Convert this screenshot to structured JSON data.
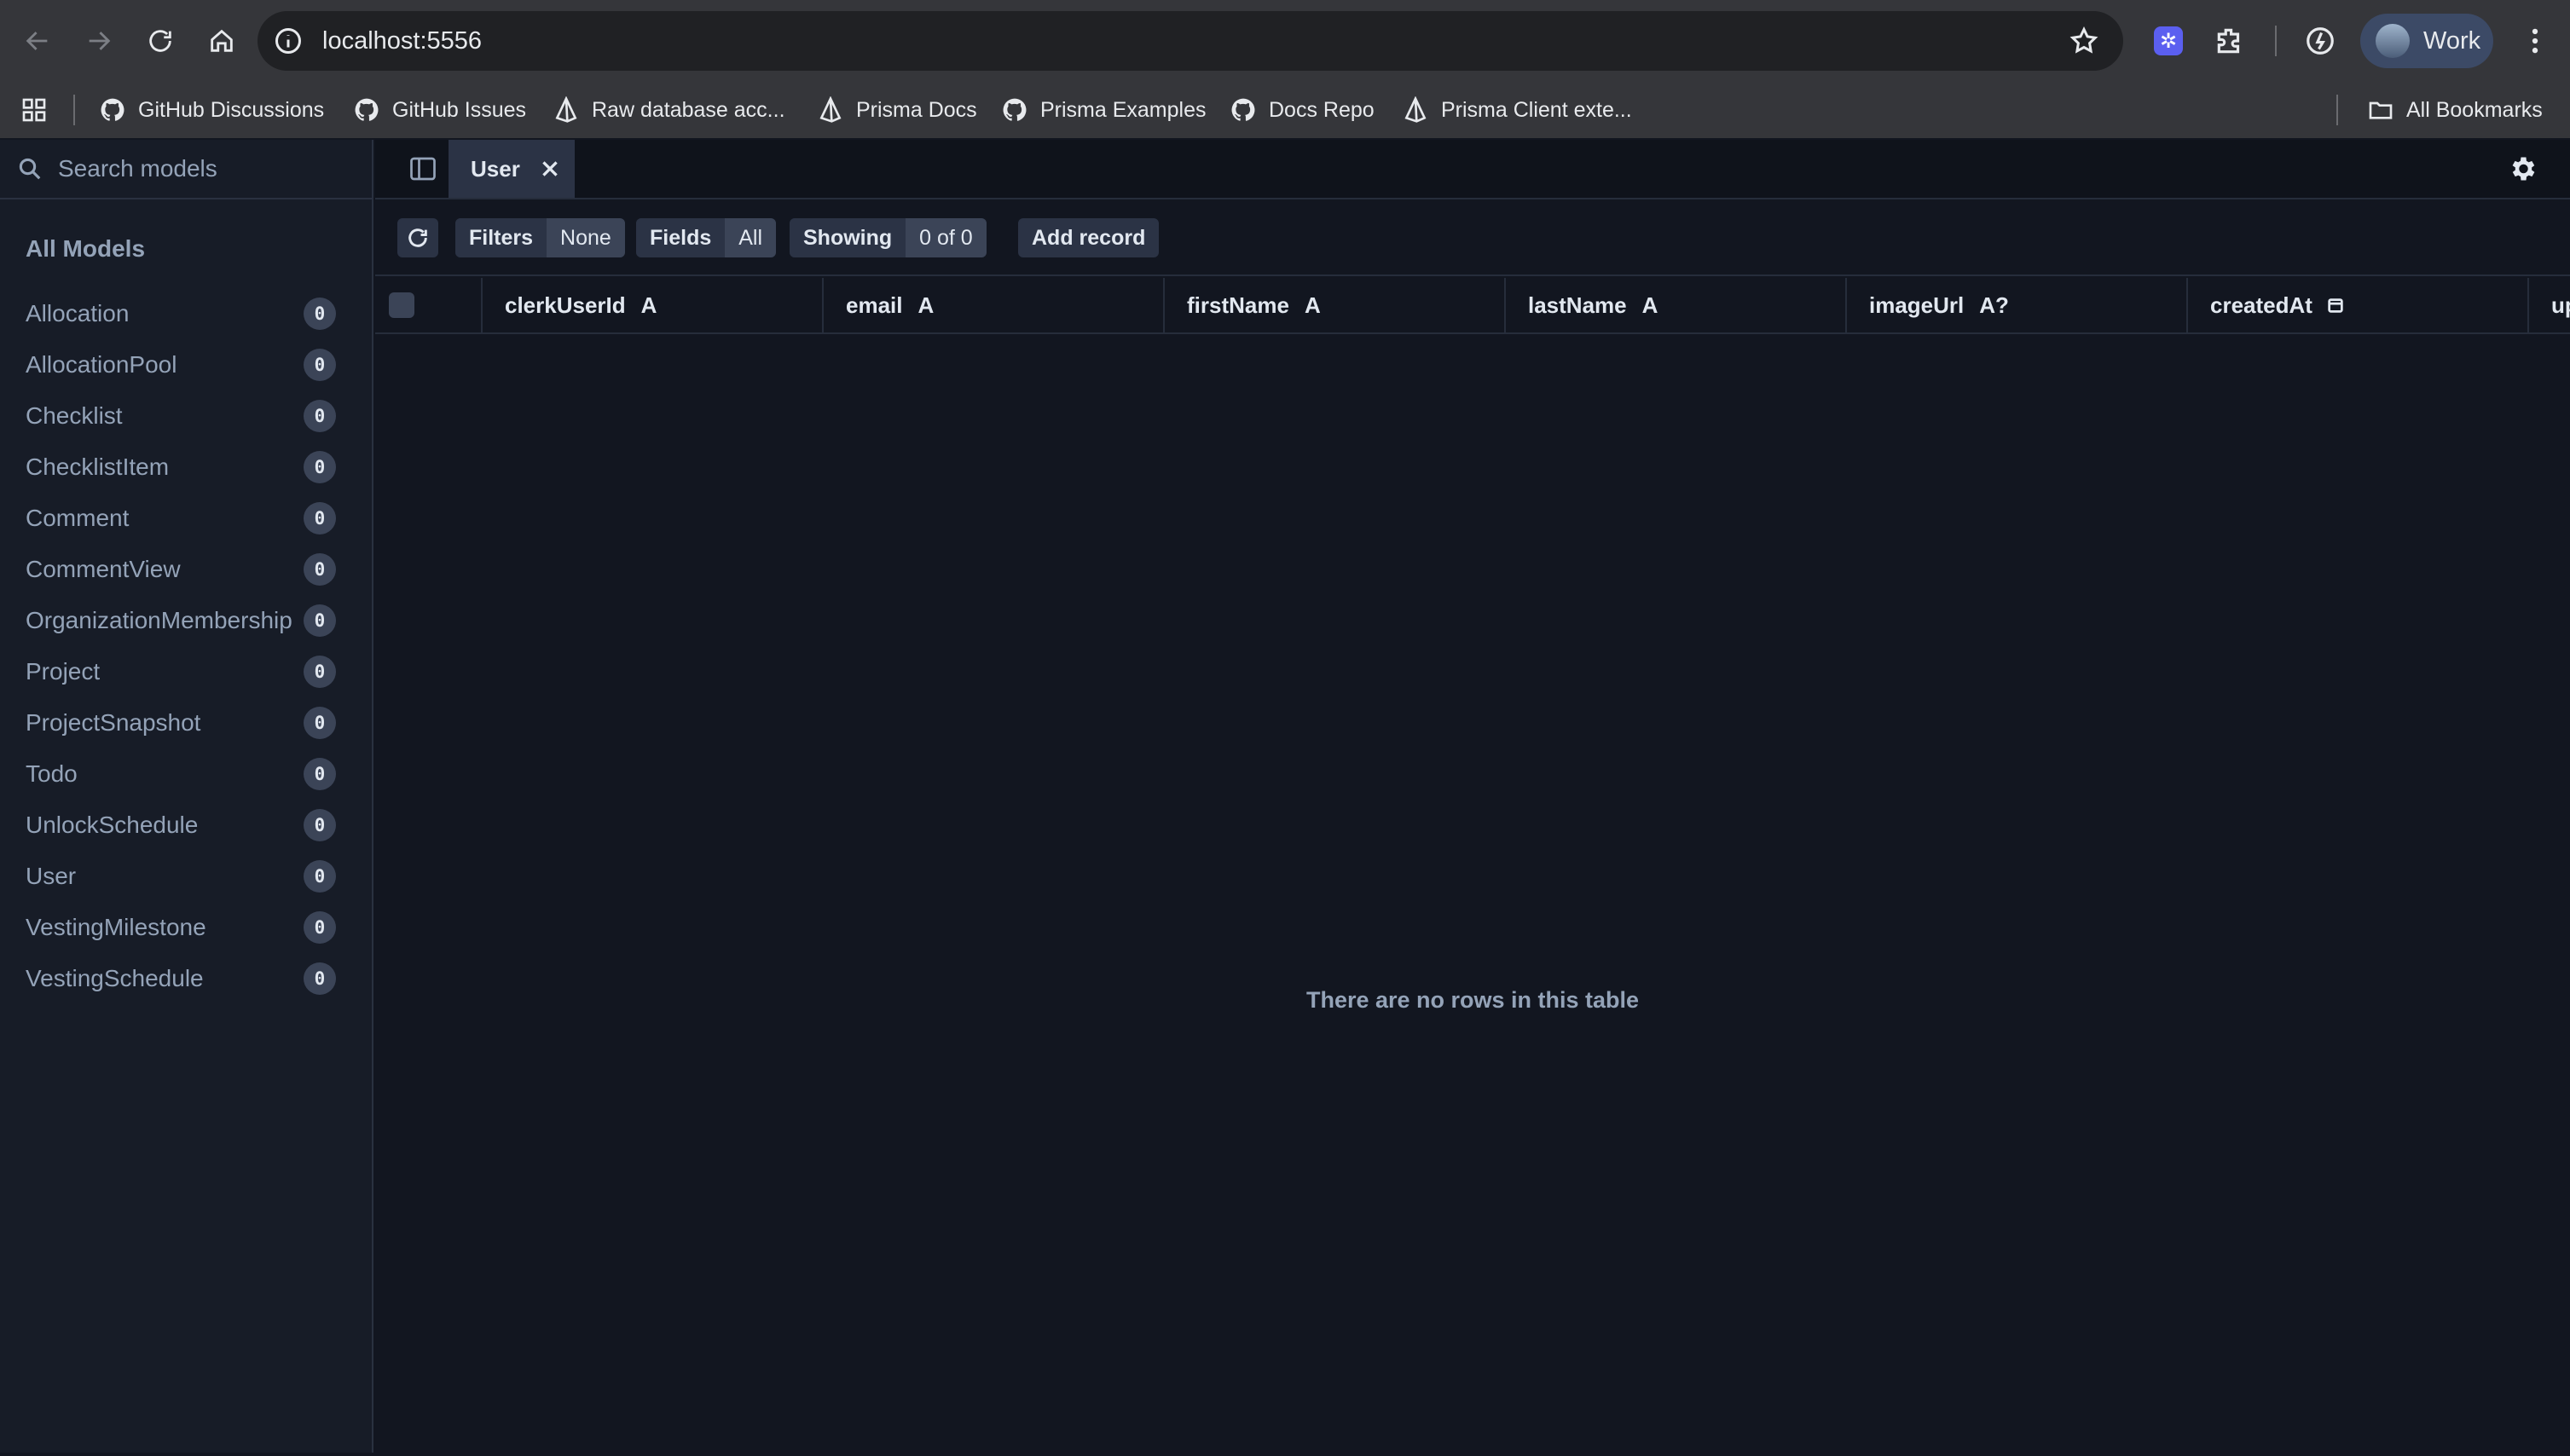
{
  "browser": {
    "url": "localhost:5556",
    "profile_name": "Work",
    "bookmarks": [
      {
        "label": "GitHub Discussions",
        "icon": "github-icon"
      },
      {
        "label": "GitHub Issues",
        "icon": "github-icon"
      },
      {
        "label": "Raw database acc...",
        "icon": "prisma-icon"
      },
      {
        "label": "Prisma Docs",
        "icon": "prisma-icon"
      },
      {
        "label": "Prisma Examples",
        "icon": "github-icon"
      },
      {
        "label": "Docs Repo",
        "icon": "github-icon"
      },
      {
        "label": "Prisma Client exte...",
        "icon": "prisma-icon"
      }
    ],
    "all_bookmarks_label": "All Bookmarks"
  },
  "sidebar": {
    "search_placeholder": "Search models",
    "heading": "All Models",
    "models": [
      {
        "name": "Allocation",
        "count": "0"
      },
      {
        "name": "AllocationPool",
        "count": "0"
      },
      {
        "name": "Checklist",
        "count": "0"
      },
      {
        "name": "ChecklistItem",
        "count": "0"
      },
      {
        "name": "Comment",
        "count": "0"
      },
      {
        "name": "CommentView",
        "count": "0"
      },
      {
        "name": "OrganizationMembership",
        "count": "0"
      },
      {
        "name": "Project",
        "count": "0"
      },
      {
        "name": "ProjectSnapshot",
        "count": "0"
      },
      {
        "name": "Todo",
        "count": "0"
      },
      {
        "name": "UnlockSchedule",
        "count": "0"
      },
      {
        "name": "User",
        "count": "0"
      },
      {
        "name": "VestingMilestone",
        "count": "0"
      },
      {
        "name": "VestingSchedule",
        "count": "0"
      }
    ]
  },
  "tabs": {
    "active_label": "User"
  },
  "actions": {
    "filters_label": "Filters",
    "filters_value": "None",
    "fields_label": "Fields",
    "fields_value": "All",
    "showing_label": "Showing",
    "showing_value": "0 of 0",
    "add_record_label": "Add record"
  },
  "columns": [
    {
      "name": "clerkUserId",
      "type": "A"
    },
    {
      "name": "email",
      "type": "A"
    },
    {
      "name": "firstName",
      "type": "A"
    },
    {
      "name": "lastName",
      "type": "A"
    },
    {
      "name": "imageUrl",
      "type": "A?"
    },
    {
      "name": "createdAt",
      "type": "calendar-icon"
    },
    {
      "name": "up",
      "type": ""
    }
  ],
  "empty_message": "There are no rows in this table",
  "colors": {
    "app_bg": "#121620",
    "sidebar_bg": "#171c27",
    "badge_bg": "#3b4457",
    "muted_text": "#94a3b8"
  }
}
